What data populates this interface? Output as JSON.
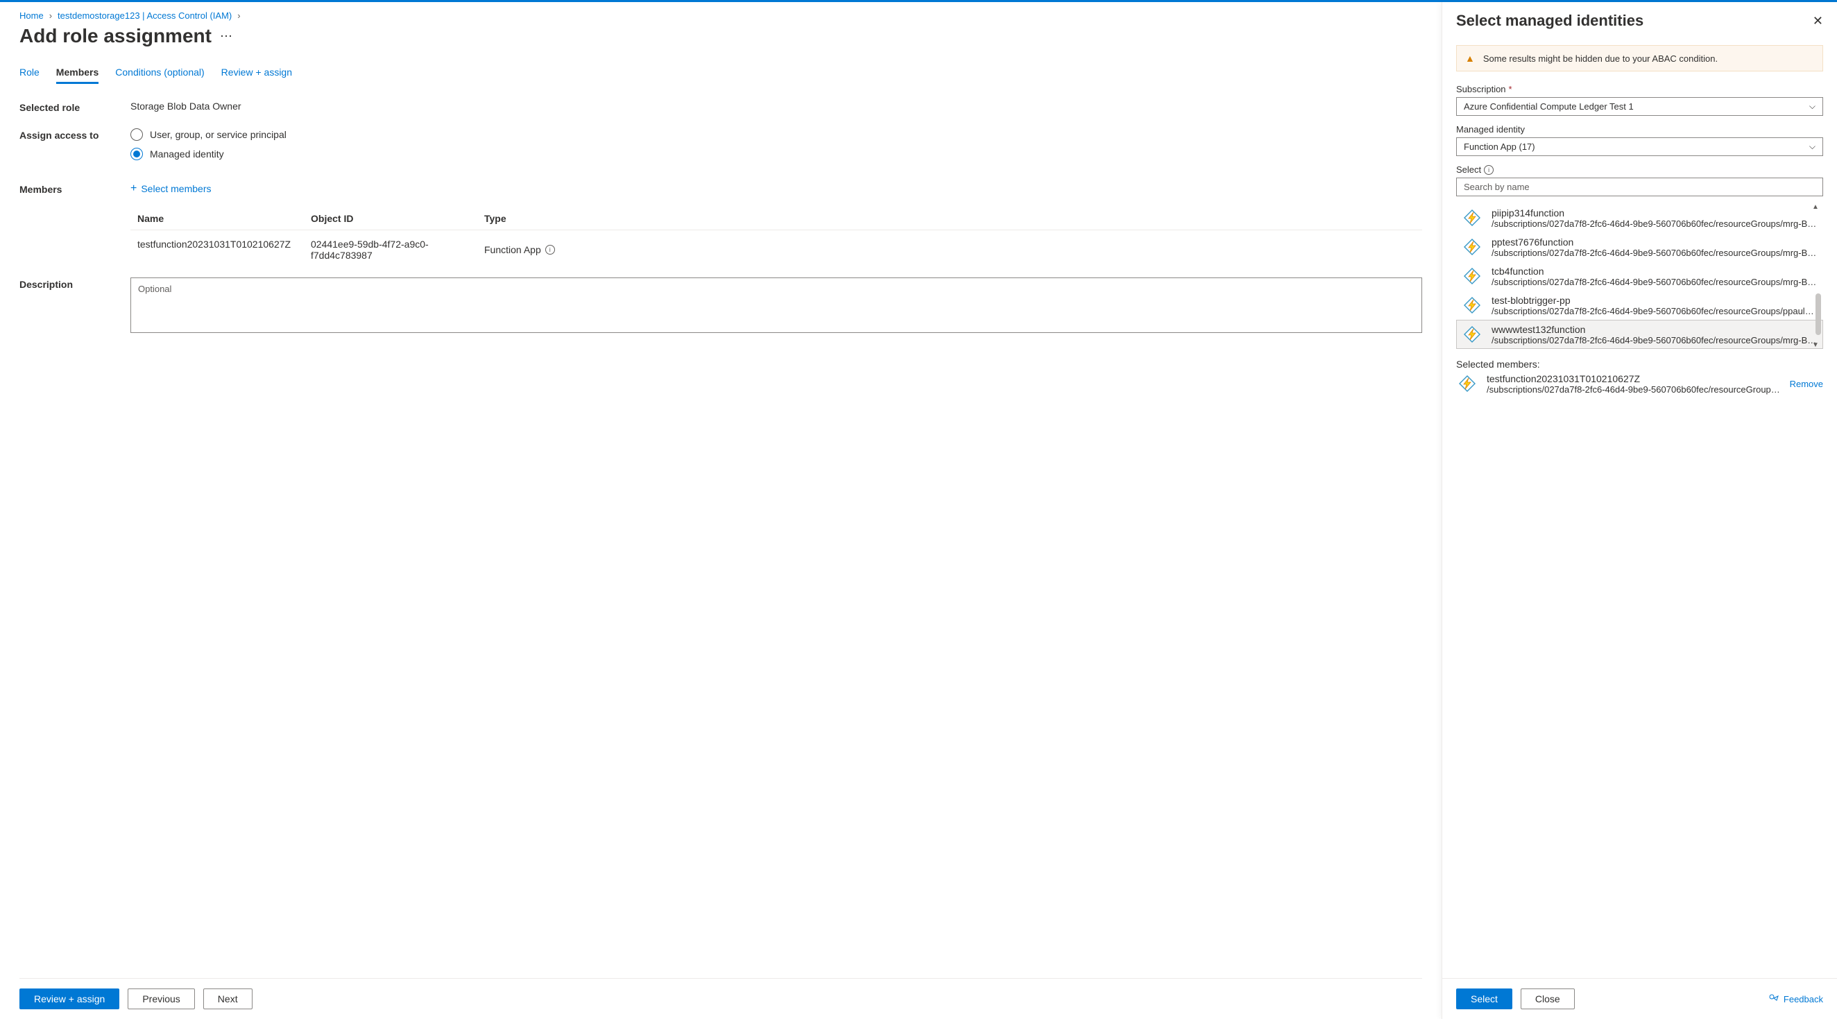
{
  "breadcrumbs": {
    "home": "Home",
    "resource": "testdemostorage123 | Access Control (IAM)"
  },
  "page_title": "Add role assignment",
  "tabs": {
    "role": "Role",
    "members": "Members",
    "conditions": "Conditions (optional)",
    "review": "Review + assign"
  },
  "form": {
    "selected_role_label": "Selected role",
    "selected_role_value": "Storage Blob Data Owner",
    "assign_access_label": "Assign access to",
    "radio_user": "User, group, or service principal",
    "radio_mi": "Managed identity",
    "members_label": "Members",
    "select_members_link": "Select members",
    "description_label": "Description",
    "description_placeholder": "Optional"
  },
  "members_table": {
    "head_name": "Name",
    "head_oid": "Object ID",
    "head_type": "Type",
    "rows": [
      {
        "name": "testfunction20231031T010210627Z",
        "oid": "02441ee9-59db-4f72-a9c0-f7dd4c783987",
        "type": "Function App"
      }
    ]
  },
  "footer": {
    "review": "Review + assign",
    "previous": "Previous",
    "next": "Next"
  },
  "panel": {
    "title": "Select managed identities",
    "banner": "Some results might be hidden due to your ABAC condition.",
    "subscription_label": "Subscription",
    "subscription_value": "Azure Confidential Compute Ledger Test 1",
    "mi_label": "Managed identity",
    "mi_value": "Function App (17)",
    "select_label": "Select",
    "search_placeholder": "Search by name",
    "results": [
      {
        "name": "piipip314function",
        "sub": "/subscriptions/027da7f8-2fc6-46d4-9be9-560706b60fec/resourceGroups/mrg-B…"
      },
      {
        "name": "pptest7676function",
        "sub": "/subscriptions/027da7f8-2fc6-46d4-9be9-560706b60fec/resourceGroups/mrg-B…"
      },
      {
        "name": "tcb4function",
        "sub": "/subscriptions/027da7f8-2fc6-46d4-9be9-560706b60fec/resourceGroups/mrg-B…"
      },
      {
        "name": "test-blobtrigger-pp",
        "sub": "/subscriptions/027da7f8-2fc6-46d4-9be9-560706b60fec/resourceGroups/ppaul…"
      },
      {
        "name": "wwwwtest132function",
        "sub": "/subscriptions/027da7f8-2fc6-46d4-9be9-560706b60fec/resourceGroups/mrg-B…"
      }
    ],
    "hovered_index": 4,
    "selected_members_label": "Selected members:",
    "selected_member": {
      "name": "testfunction20231031T010210627Z",
      "sub": "/subscriptions/027da7f8-2fc6-46d4-9be9-560706b60fec/resourceGroups/…"
    },
    "remove": "Remove",
    "select_btn": "Select",
    "close_btn": "Close",
    "feedback": "Feedback"
  }
}
